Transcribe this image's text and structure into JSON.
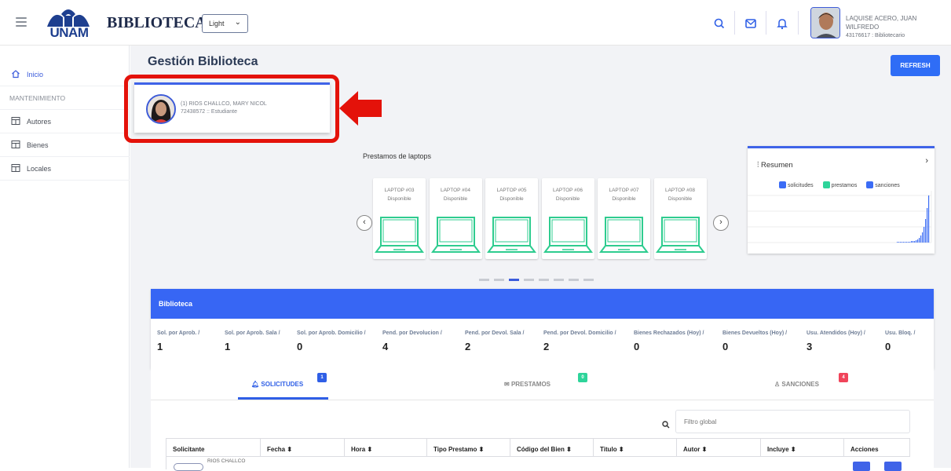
{
  "header": {
    "logo_text": "UNAM",
    "brand": "BIBLIOTECA",
    "theme_select": "Light",
    "user": {
      "name": "LAQUISE ACERO, JUAN WILFREDO",
      "role": "43176617 : Bibliotecario"
    }
  },
  "sidebar": {
    "items": [
      {
        "label": "Inicio",
        "icon": "home-icon"
      },
      {
        "label": "MANTENIMIENTO"
      },
      {
        "label": "Autores",
        "icon": "table-icon"
      },
      {
        "label": "Bienes",
        "icon": "table-icon"
      },
      {
        "label": "Locales",
        "icon": "table-icon"
      }
    ]
  },
  "page": {
    "title": "Gestión Biblioteca",
    "refresh_label": "REFRESH"
  },
  "student": {
    "name": "(1) RIOS CHALLCO, MARY NICOL",
    "detail": "72438572 :: Estudiante"
  },
  "carousel": {
    "title": "Prestamos de laptops",
    "items": [
      {
        "name": "LAPTOP #03",
        "status": "Disponible"
      },
      {
        "name": "LAPTOP #04",
        "status": "Disponible"
      },
      {
        "name": "LAPTOP #05",
        "status": "Disponible"
      },
      {
        "name": "LAPTOP #06",
        "status": "Disponible"
      },
      {
        "name": "LAPTOP #07",
        "status": "Disponible"
      },
      {
        "name": "LAPTOP #08",
        "status": "Disponible"
      }
    ],
    "page_count": 8,
    "active_page": 3,
    "laptop_color": "#2ecc8f"
  },
  "resumen": {
    "title": "Resumen",
    "legend": [
      {
        "label": "solicitudes",
        "color": "#3b6cf5"
      },
      {
        "label": "prestamos",
        "color": "#2ed49a"
      },
      {
        "label": "sanciones",
        "color": "#3b6cf5"
      }
    ]
  },
  "biblioteca": {
    "title": "Biblioteca",
    "stats": [
      {
        "label": "Sol. por Aprob. /",
        "value": "1"
      },
      {
        "label": "Sol. por Aprob. Sala /",
        "value": "1"
      },
      {
        "label": "Sol. por Aprob. Domicilio /",
        "value": "0"
      },
      {
        "label": "Pend. por Devolucion /",
        "value": "4"
      },
      {
        "label": "Pend. por Devol. Sala /",
        "value": "2"
      },
      {
        "label": "Pend. por Devol. Domicilio /",
        "value": "2"
      },
      {
        "label": "Bienes Rechazados (Hoy) /",
        "value": "0"
      },
      {
        "label": "Bienes Devueltos (Hoy) /",
        "value": "0"
      },
      {
        "label": "Usu. Atendidos (Hoy) /",
        "value": "3"
      },
      {
        "label": "Usu. Bloq. /",
        "value": "0"
      }
    ]
  },
  "tabs": [
    {
      "label": "SOLICITUDES",
      "badge": "1",
      "badge_color": "#2f5fe6"
    },
    {
      "label": "PRESTAMOS",
      "badge": "0",
      "badge_color": "#2ed49a"
    },
    {
      "label": "SANCIONES",
      "badge": "4",
      "badge_color": "#f0445a"
    }
  ],
  "table": {
    "search_placeholder": "Filtro global",
    "columns": [
      "Solicitante",
      "Fecha",
      "Hora",
      "Tipo Prestamo",
      "Código del Bien",
      "Titulo",
      "Autor",
      "Incluye",
      "Acciones"
    ],
    "rows": [
      {
        "solicitante": "RIOS CHALLCO"
      }
    ]
  }
}
